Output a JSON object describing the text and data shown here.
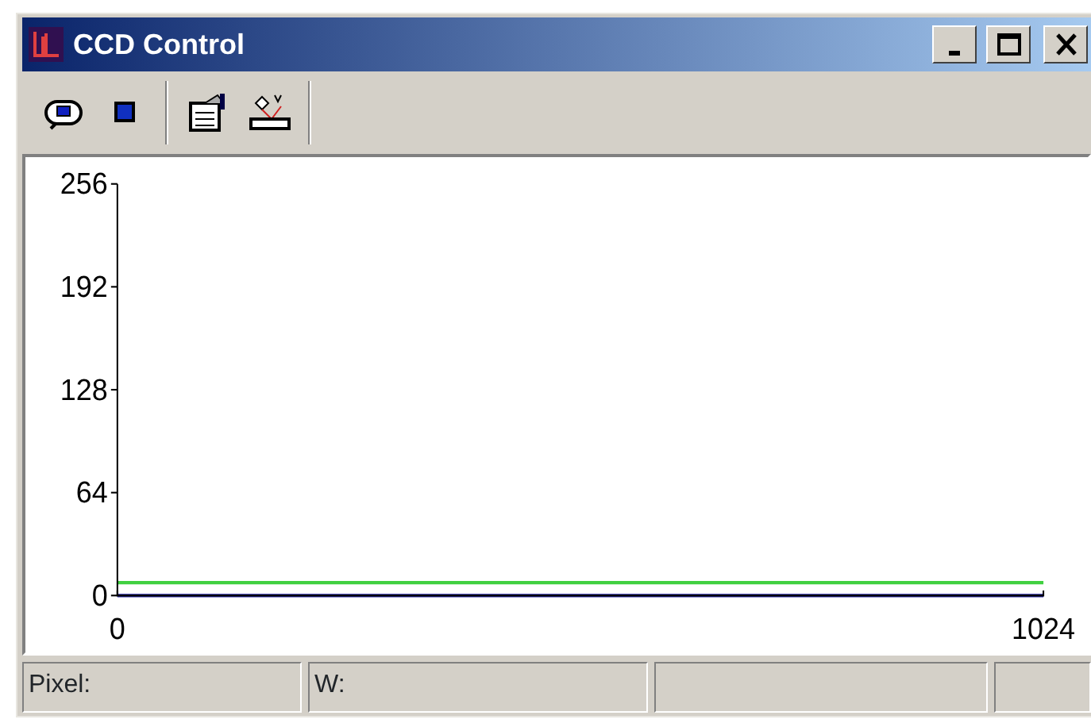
{
  "window": {
    "title": "CCD Control",
    "controls": [
      {
        "kind": "minimize"
      },
      {
        "kind": "maximize"
      },
      {
        "kind": "close"
      }
    ]
  },
  "toolbar": {
    "groups": [
      [
        {
          "kind": "loop"
        },
        {
          "kind": "single"
        }
      ],
      [
        {
          "kind": "settings"
        },
        {
          "kind": "calibrate"
        }
      ]
    ]
  },
  "plot": {
    "chart_data": {
      "type": "line",
      "x": [
        0,
        1024
      ],
      "series": [
        {
          "color": "#40d040",
          "values": [
            8,
            8
          ]
        },
        {
          "color": "#2020a0",
          "values": [
            0,
            0
          ]
        }
      ],
      "xlim": [
        0,
        1024
      ],
      "ylim": [
        0,
        256
      ],
      "xticks": [
        0,
        1024
      ],
      "yticks": [
        0,
        64,
        128,
        192,
        256
      ]
    }
  },
  "status_bar": [
    {
      "kind": "text",
      "text": "Pixel:"
    },
    {
      "kind": "text",
      "text": "W:"
    },
    {
      "kind": "empty"
    },
    {
      "kind": "empty"
    }
  ]
}
